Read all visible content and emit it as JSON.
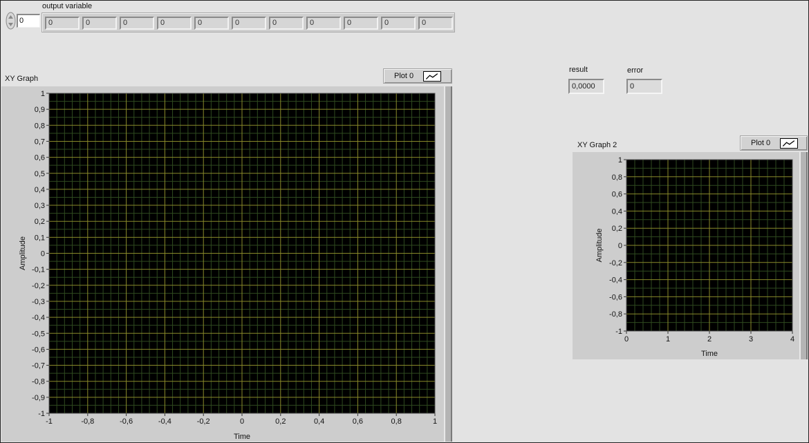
{
  "output_variable": {
    "label": "output variable",
    "index": "0",
    "values": [
      "0",
      "0",
      "0",
      "0",
      "0",
      "0",
      "0",
      "0",
      "0",
      "0",
      "0"
    ]
  },
  "result": {
    "label": "result",
    "value": "0,0000"
  },
  "error": {
    "label": "error",
    "value": "0"
  },
  "graph1": {
    "label": "XY Graph",
    "legend_label": "Plot 0",
    "xlabel": "Time",
    "ylabel": "Amplitude",
    "x_ticks": [
      "-1",
      "-0,8",
      "-0,6",
      "-0,4",
      "-0,2",
      "0",
      "0,2",
      "0,4",
      "0,6",
      "0,8",
      "1"
    ],
    "y_ticks": [
      "1",
      "0,9",
      "0,8",
      "0,7",
      "0,6",
      "0,5",
      "0,4",
      "0,3",
      "0,2",
      "0,1",
      "0",
      "-0,1",
      "-0,2",
      "-0,3",
      "-0,4",
      "-0,5",
      "-0,6",
      "-0,7",
      "-0,8",
      "-0,9",
      "-1"
    ],
    "plot_bg": "#000000",
    "grid_color": "#8a8a2a",
    "minor_grid_color": "#2f4a1f"
  },
  "graph2": {
    "label": "XY Graph 2",
    "legend_label": "Plot 0",
    "xlabel": "Time",
    "ylabel": "Amplitude",
    "x_ticks": [
      "0",
      "1",
      "2",
      "3",
      "4"
    ],
    "y_ticks": [
      "1",
      "0,8",
      "0,6",
      "0,4",
      "0,2",
      "0",
      "-0,2",
      "-0,4",
      "-0,6",
      "-0,8",
      "-1"
    ],
    "plot_bg": "#000000",
    "grid_color": "#8a8a2a",
    "minor_grid_color": "#2f4a1f"
  }
}
